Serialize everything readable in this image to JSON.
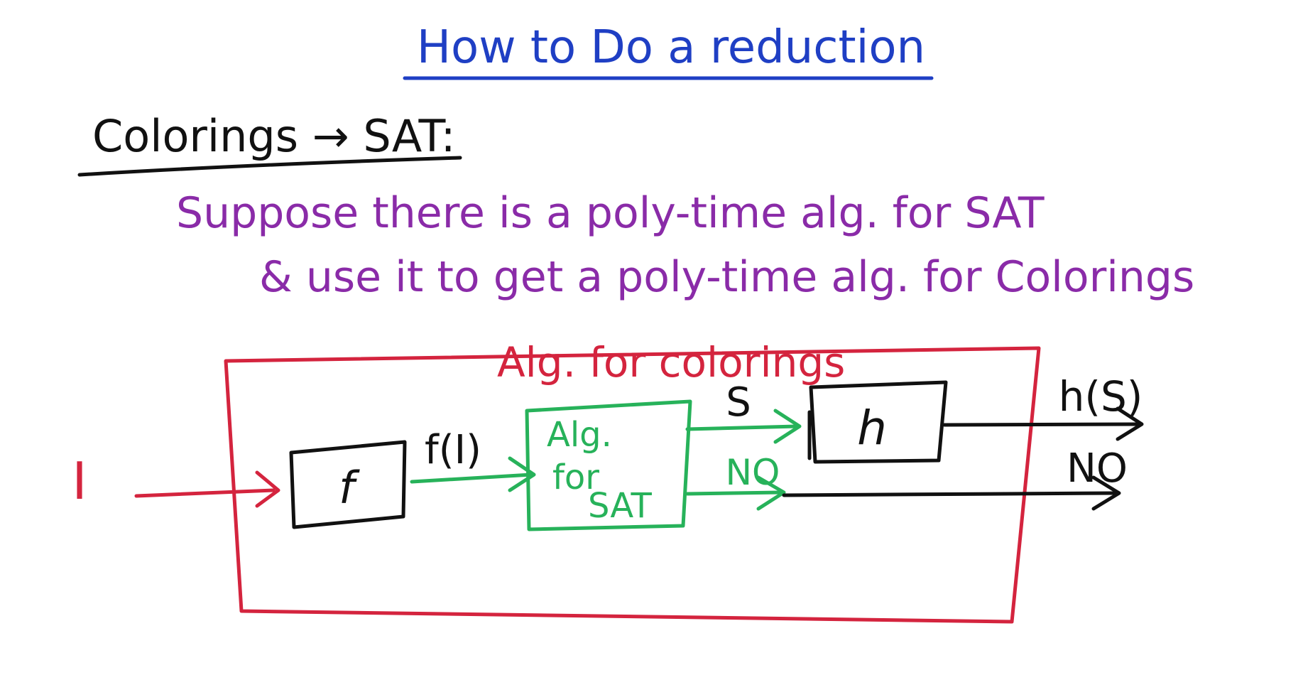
{
  "slide": {
    "title": "How to Do a reduction",
    "section_heading": "Colorings → SAT:",
    "statement_line1": "Suppose there is a poly-time alg. for SAT",
    "statement_line2": "& use it to get a poly-time alg. for Colorings"
  },
  "diagram": {
    "outer_box_label": "Alg. for colorings",
    "input_label": "I",
    "f_box_label": "f",
    "f_output_label": "f(I)",
    "sat_box_line1": "Alg.",
    "sat_box_line2": "for",
    "sat_box_line3": "SAT",
    "solution_label": "S",
    "no_label_inner": "NO",
    "h_box_label": "h",
    "h_output_label": "h(S)",
    "no_label_outer": "NO"
  },
  "colors": {
    "title": "#1f3fc4",
    "purple": "#8a2ba8",
    "red": "#d4243e",
    "green": "#27b25a",
    "black": "#111111"
  }
}
